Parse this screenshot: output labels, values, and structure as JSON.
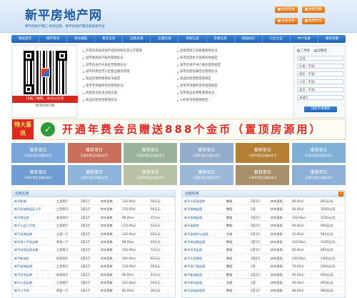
{
  "header": {
    "title": "新平房地产网",
    "slogan": "新平房地产网|二手房出售、新平房地产网信息发布平台",
    "buttons": [
      {
        "label": "会员登录",
        "icon": "user-icon"
      },
      {
        "label": "免费注册",
        "icon": "register-icon"
      },
      {
        "label": "会员发布",
        "icon": "publish-icon"
      },
      {
        "label": "免费登记",
        "icon": "edit-icon"
      }
    ]
  },
  "nav": {
    "items": [
      "网站首页",
      "楼市快讯",
      "新房楼盘",
      "售房信息",
      "出售房源",
      "出租房源",
      "求购信息",
      "求租信息",
      "地图找房",
      "小区大全",
      "中介名录",
      "联系客服"
    ]
  },
  "promo": {
    "caption": "扫描二维码，关注公众号",
    "sub_caption": "新平房地产网"
  },
  "news": {
    "left": [
      "云南云南省房地产经纪机构信息公示管理",
      "城市规划房产服务管理办法",
      "城市房地产开发经营管理办法",
      "城市新建住宅小区物业服务管理",
      "商品房销售管理办法规定",
      "住宅专项维修资金管理办法",
      "房屋登记办法法规实施",
      "商品房屋租赁管理办法"
    ],
    "right": [
      "房屋建筑工程质量保修办法",
      "城市房屋拆迁管理条例规定",
      "城市房地产中介服务管理规定",
      "城市房屋权属登记管理办法",
      "商品房屋销售管理规定",
      "住宅专项维修资金管理规定",
      "城市商品房预售管理办法",
      "公积金贷款管理规定"
    ]
  },
  "search": {
    "type_options": [
      "二手房",
      "出租房"
    ],
    "fields": [
      {
        "label": "区域",
        "value": ""
      },
      {
        "label": "价格",
        "value": "--不限--"
      },
      {
        "label": "面积",
        "value": "--不限--"
      },
      {
        "label": "户型",
        "value": "--不限--"
      },
      {
        "label": "类型",
        "value": "--不限--"
      },
      {
        "label": "关键字",
        "value": ""
      }
    ],
    "button": "找房子来搜索"
  },
  "banner": {
    "badge": "特大喜讯",
    "text": "开通年费会员赠送888个金币（置顶房源用）"
  },
  "ads": [
    {
      "title": "推荐单位",
      "sub": "开通年费会员赠送金币",
      "color": "#7aa5d8"
    },
    {
      "title": "推荐单位",
      "sub": "开通年费会员赠送金币",
      "color": "#c96f5b"
    },
    {
      "title": "推荐单位",
      "sub": "开通年费会员赠送金币",
      "color": "#9ab29a"
    },
    {
      "title": "推荐单位",
      "sub": "开通年费会员赠送金币",
      "color": "#93acc9"
    },
    {
      "title": "推荐单位",
      "sub": "开通年费会员赠送金币",
      "color": "#b57f36"
    },
    {
      "title": "推荐单位",
      "sub": "开通年费会员赠送金币",
      "color": "#7db0d4"
    },
    {
      "title": "推荐单位",
      "sub": "开通年费会员赠送金币",
      "color": "#6f9dd1"
    },
    {
      "title": "推荐单位",
      "sub": "开通年费会员赠送金币",
      "color": "#8fb4dc"
    },
    {
      "title": "推荐单位",
      "sub": "开通年费会员赠送金币",
      "color": "#b6c2a3"
    },
    {
      "title": "推荐单位",
      "sub": "开通年费会员赠送金币",
      "color": "#9cb8d8"
    },
    {
      "title": "推荐单位",
      "sub": "开通年费会员赠送金币",
      "color": "#a98f6a"
    },
    {
      "title": "推荐单位",
      "sub": "开通年费会员赠送金币",
      "color": "#8fb0d6"
    }
  ],
  "sale": {
    "header": "出售房源",
    "rows": [
      [
        "新平新城",
        "三室两厅",
        "2室1厅",
        "房东直售",
        "120.00㎡",
        "58万元"
      ],
      [
        "新平县城商业区二手",
        "三室两厅",
        "3室2厅",
        "房东直售",
        "135.00㎡",
        "69万元"
      ],
      [
        "新平商品房",
        "两室两厅",
        "2室2厅",
        "房东直售",
        "98.00㎡",
        "45万元"
      ],
      [
        "新平小区二手房",
        "三室两厅",
        "3室2厅",
        "房东直售",
        "110.00㎡",
        "52万元"
      ],
      [
        "新平县城出售",
        "三室一厅",
        "3室1厅",
        "房东直售",
        "126.00㎡",
        "60万元"
      ],
      [
        "新平县二手房出售",
        "两室一厅",
        "2室1厅",
        "房东直售",
        "88.00㎡",
        "40万元"
      ],
      [
        "新平县商品房出售",
        "三室两厅",
        "3室2厅",
        "房东直售",
        "140.00㎡",
        "72万元"
      ],
      [
        "新平新城区",
        "四室两厅",
        "4室2厅",
        "房东直售",
        "160.00㎡",
        "85万元"
      ],
      [
        "新平县城出售",
        "三室两厅",
        "3室2厅",
        "房东直售",
        "118.00㎡",
        "56万元"
      ],
      [
        "新平住宅出售",
        "两室两厅",
        "2室2厅",
        "房东直售",
        "96.00㎡",
        "43万元"
      ],
      [
        "新平小区出售",
        "三室两厅",
        "3室2厅",
        "房东直售",
        "125.00㎡",
        "59万元"
      ],
      [
        "新平二手房",
        "两室一厅",
        "2室1厅",
        "房东直售",
        "80.00㎡",
        "36万元"
      ]
    ]
  },
  "rent": {
    "header": "出租房源",
    "rows": [
      [
        "新平小区出租房",
        "整租",
        "2室1厅",
        "房东直租",
        "80.00㎡",
        "800元/月"
      ],
      [
        "新平商铺出租",
        "整租",
        "1室",
        "房东直租",
        "60.00㎡",
        "1500元/月"
      ],
      [
        "新平县城出租",
        "整租",
        "3室2厅",
        "房东直租",
        "120.00㎡",
        "1200元/月"
      ],
      [
        "新平出租房",
        "整租",
        "2室2厅",
        "房东直租",
        "90.00㎡",
        "900元/月"
      ],
      [
        "新平县城中心出租",
        "合租",
        "1室1厅",
        "房东直租",
        "45.00㎡",
        "500元/月"
      ],
      [
        "新平商业楼出租",
        "整租",
        "3室1厅",
        "房东直租",
        "110.00㎡",
        "1100元/月"
      ],
      [
        "新平住宅出租",
        "整租",
        "2室1厅",
        "房东直租",
        "85.00㎡",
        "850元/月"
      ],
      [
        "新平小区整租",
        "整租",
        "3室2厅",
        "房东直租",
        "130.00㎡",
        "1300元/月"
      ],
      [
        "新平县门面出租",
        "整租",
        "1室",
        "房东直租",
        "70.00㎡",
        "2000元/月"
      ],
      [
        "新平新城出租",
        "整租",
        "2室2厅",
        "房东直租",
        "95.00㎡",
        "950元/月"
      ],
      [
        "新平单间出租",
        "合租",
        "1室",
        "房东直租",
        "30.00㎡",
        "400元/月"
      ],
      [
        "新平县城出租房",
        "整租",
        "2室1厅",
        "房东直租",
        "88.00㎡",
        "880元/月"
      ]
    ]
  }
}
